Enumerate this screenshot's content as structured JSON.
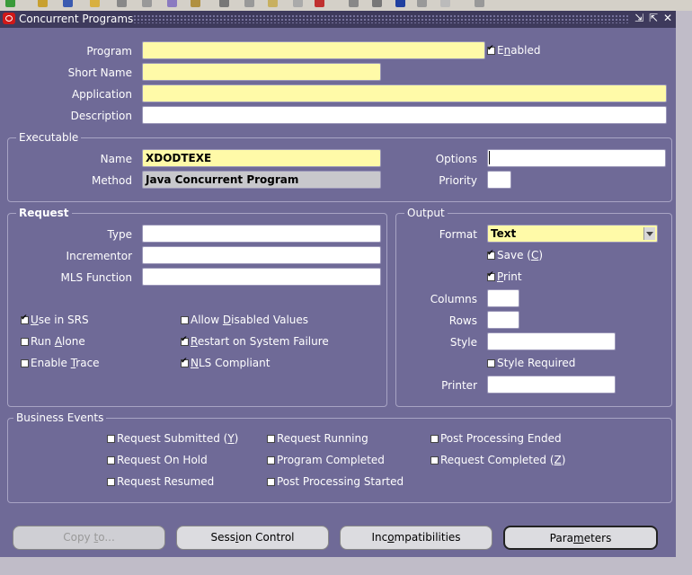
{
  "window": {
    "title": "Concurrent Programs"
  },
  "header": {
    "program": {
      "label": "Program",
      "value": ""
    },
    "enabled": {
      "label": "Enabled",
      "checked": true
    },
    "short_name": {
      "label": "Short Name",
      "value": ""
    },
    "application": {
      "label": "Application",
      "value": ""
    },
    "description": {
      "label": "Description",
      "value": ""
    }
  },
  "executable": {
    "title": "Executable",
    "name": {
      "label": "Name",
      "value": "XDODTEXE"
    },
    "method": {
      "label": "Method",
      "value": "Java Concurrent Program"
    },
    "options": {
      "label": "Options",
      "value": ""
    },
    "priority": {
      "label": "Priority",
      "value": ""
    }
  },
  "request": {
    "title": "Request",
    "type": {
      "label": "Type",
      "value": ""
    },
    "incrementor": {
      "label": "Incrementor",
      "value": ""
    },
    "mls_function": {
      "label": "MLS Function",
      "value": ""
    },
    "checks": [
      {
        "pre": "",
        "u": "U",
        "post": "se in SRS",
        "checked": true
      },
      {
        "pre": "Allow ",
        "u": "D",
        "post": "isabled Values",
        "checked": false
      },
      {
        "pre": "Run ",
        "u": "A",
        "post": "lone",
        "checked": false
      },
      {
        "pre": "",
        "u": "R",
        "post": "estart on System Failure",
        "checked": true
      },
      {
        "pre": "Enable ",
        "u": "T",
        "post": "race",
        "checked": false
      },
      {
        "pre": "",
        "u": "N",
        "post": "LS Compliant",
        "checked": true
      }
    ]
  },
  "output": {
    "title": "Output",
    "format": {
      "label": "Format",
      "value": "Text"
    },
    "save": {
      "pre": "Save (",
      "u": "C",
      "post": ")",
      "checked": true
    },
    "print": {
      "pre": "",
      "u": "P",
      "post": "rint",
      "checked": true
    },
    "columns": {
      "label": "Columns",
      "value": ""
    },
    "rows": {
      "label": "Rows",
      "value": ""
    },
    "style": {
      "label": "Style",
      "value": ""
    },
    "style_required": {
      "label": "Style Required",
      "checked": false
    },
    "printer": {
      "label": "Printer",
      "value": ""
    }
  },
  "business_events": {
    "title": "Business Events",
    "items": [
      {
        "pre": "Request Submitted (",
        "u": "Y",
        "post": ")",
        "checked": false
      },
      {
        "pre": "Request Running",
        "u": "",
        "post": "",
        "checked": false
      },
      {
        "pre": "Post Processing Ended",
        "u": "",
        "post": "",
        "checked": false
      },
      {
        "pre": "Request On Hold",
        "u": "",
        "post": "",
        "checked": false
      },
      {
        "pre": "Program Completed",
        "u": "",
        "post": "",
        "checked": false
      },
      {
        "pre": "Request Completed (",
        "u": "Z",
        "post": ")",
        "checked": false
      },
      {
        "pre": "Request Resumed",
        "u": "",
        "post": "",
        "checked": false
      },
      {
        "pre": "Post Processing Started",
        "u": "",
        "post": "",
        "checked": false
      }
    ]
  },
  "buttons": {
    "copy": {
      "pre": "Copy ",
      "u": "t",
      "post": "o..."
    },
    "session": {
      "pre": "Sess",
      "u": "i",
      "post": "on Control"
    },
    "incompat": {
      "pre": "Inc",
      "u": "o",
      "post": "mpatibilities"
    },
    "params": {
      "pre": "Para",
      "u": "m",
      "post": "eters"
    }
  },
  "colors": {
    "window_bg": "#6f6a97",
    "required_field": "#fffaa8",
    "titlebar": "#3e3a5c"
  }
}
